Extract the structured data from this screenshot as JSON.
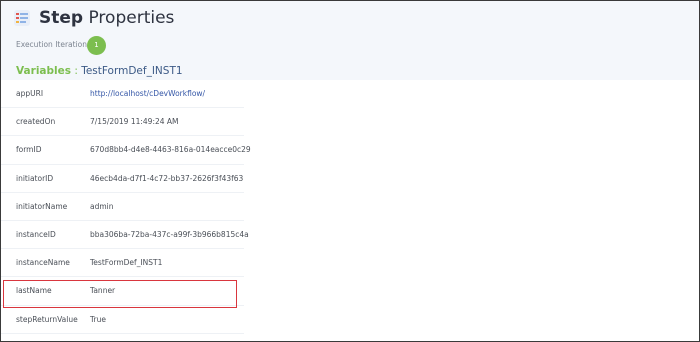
{
  "header": {
    "title_bold": "Step",
    "title_rest": " Properties",
    "logo_icon": "list-icon"
  },
  "execution": {
    "label": "Execution Iteration:",
    "value": "1",
    "badge_color": "#7cbe4f"
  },
  "variables": {
    "heading": "Variables",
    "separator": " : ",
    "instance": "TestFormDef_INST1"
  },
  "rows": [
    {
      "key": "appURI",
      "value": "http://localhost/cDevWorkflow/"
    },
    {
      "key": "createdOn",
      "value": "7/15/2019 11:49:24 AM"
    },
    {
      "key": "formID",
      "value": "670d8bb4-d4e8-4463-816a-014eacce0c29"
    },
    {
      "key": "initiatorID",
      "value": "46ecb4da-d7f1-4c72-bb37-2626f3f43f63"
    },
    {
      "key": "initiatorName",
      "value": "admin"
    },
    {
      "key": "instanceID",
      "value": "bba306ba-72ba-437c-a99f-3b966b815c4a"
    },
    {
      "key": "instanceName",
      "value": "TestFormDef_INST1"
    },
    {
      "key": "lastName",
      "value": "Tanner"
    },
    {
      "key": "stepReturnValue",
      "value": "True"
    }
  ],
  "colors": {
    "accent_green": "#7cbe4f",
    "link_blue": "#3557a7",
    "highlight_red": "#d9363e"
  }
}
